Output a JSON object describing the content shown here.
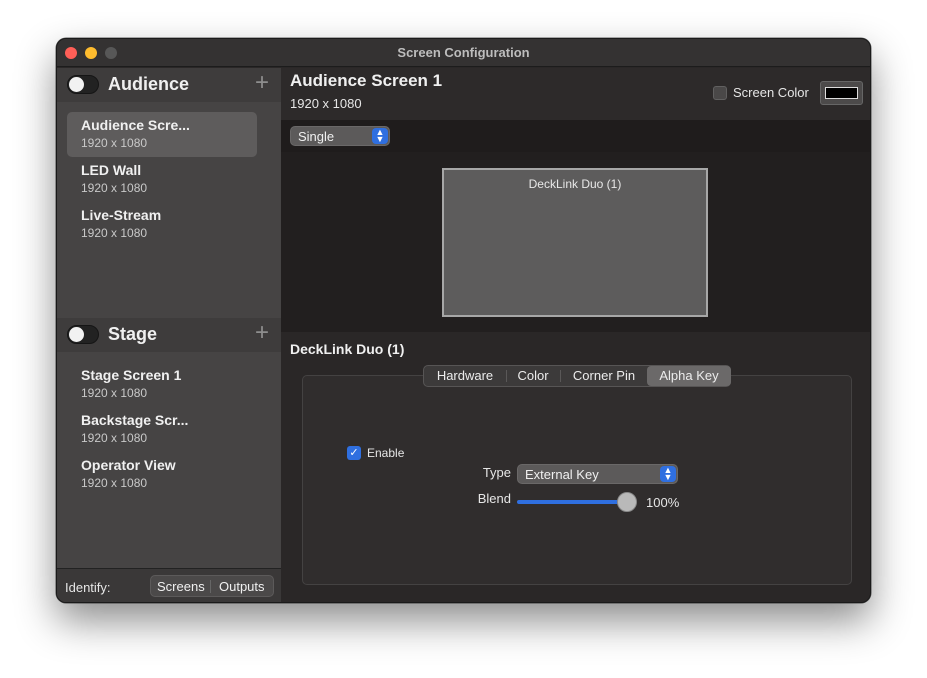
{
  "window": {
    "title": "Screen Configuration"
  },
  "sidebar": {
    "groups": [
      {
        "title": "Audience",
        "items": [
          {
            "name": "Audience Scre...",
            "resolution": "1920 x 1080",
            "selected": true
          },
          {
            "name": "LED Wall",
            "resolution": "1920 x 1080",
            "selected": false
          },
          {
            "name": "Live-Stream",
            "resolution": "1920 x 1080",
            "selected": false
          }
        ]
      },
      {
        "title": "Stage",
        "items": [
          {
            "name": "Stage Screen 1",
            "resolution": "1920 x 1080",
            "selected": false
          },
          {
            "name": "Backstage Scr...",
            "resolution": "1920 x 1080",
            "selected": false
          },
          {
            "name": "Operator View",
            "resolution": "1920 x 1080",
            "selected": false
          }
        ]
      }
    ],
    "footer": {
      "identify_label": "Identify:",
      "screens_button": "Screens",
      "outputs_button": "Outputs"
    }
  },
  "main": {
    "screen_title": "Audience Screen 1",
    "screen_resolution": "1920 x 1080",
    "screen_color_label": "Screen Color",
    "screen_color": "#000000",
    "layout_mode": "Single",
    "output_label": "DeckLink Duo (1)",
    "detail_title": "DeckLink Duo (1)",
    "tabs": [
      {
        "label": "Hardware",
        "active": false
      },
      {
        "label": "Color",
        "active": false
      },
      {
        "label": "Corner Pin",
        "active": false
      },
      {
        "label": "Alpha Key",
        "active": true
      }
    ],
    "alpha_key": {
      "enable_label": "Enable",
      "enabled": true,
      "type_label": "Type",
      "type_value": "External Key",
      "blend_label": "Blend",
      "blend_value": "100%"
    }
  },
  "colors": {
    "accent": "#2f6fe0",
    "close": "#ff5f57",
    "minimize": "#febc2e"
  }
}
